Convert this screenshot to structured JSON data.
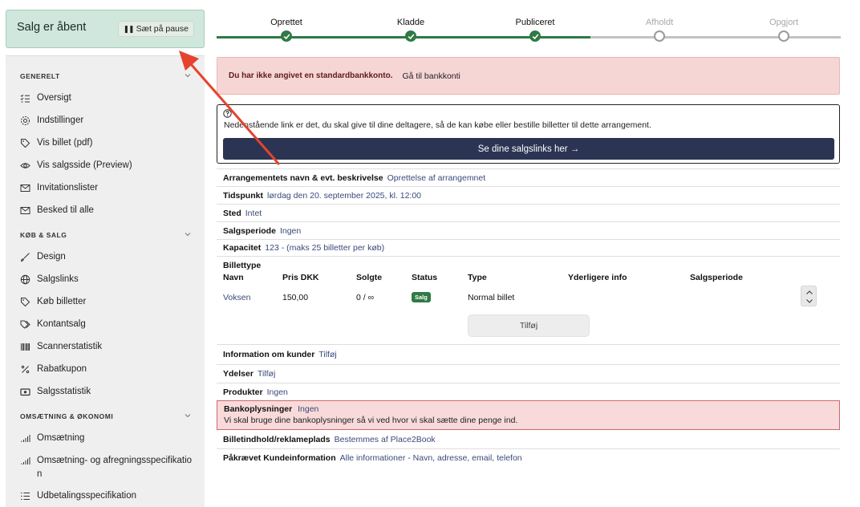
{
  "sales_status": {
    "title": "Salg er åbent",
    "pause_label": "Sæt på pause"
  },
  "sidebar": {
    "sections": [
      {
        "title": "GENERELT",
        "items": [
          "Oversigt",
          "Indstillinger",
          "Vis billet (pdf)",
          "Vis salgsside (Preview)",
          "Invitationslister",
          "Besked til alle"
        ]
      },
      {
        "title": "KØB & SALG",
        "items": [
          "Design",
          "Salgslinks",
          "Køb billetter",
          "Kontantsalg",
          "Scannerstatistik",
          "Rabatkupon",
          "Salgsstatistik"
        ]
      },
      {
        "title": "OMSÆTNING & ØKONOMI",
        "items": [
          "Omsætning",
          "Omsætning- og afregningsspecifikation",
          "Udbetalingsspecifikation"
        ]
      }
    ]
  },
  "stepper": {
    "steps": [
      {
        "label": "Oprettet",
        "done": true
      },
      {
        "label": "Kladde",
        "done": true
      },
      {
        "label": "Publiceret",
        "done": true
      },
      {
        "label": "Afholdt",
        "done": false
      },
      {
        "label": "Opgjort",
        "done": false
      }
    ],
    "colors": {
      "done": "#2f7a46",
      "todo": "#9a9a9a"
    }
  },
  "alert": {
    "text": "Du har ikke angivet en standardbankkonto.",
    "link": "Gå til bankkonti"
  },
  "info": {
    "message": "Nedenstående link er det, du skal give til dine deltagere, så de kan købe eller bestille billetter til dette arrangement.",
    "cta": "Se dine salgslinks her →"
  },
  "details": {
    "name": {
      "label": "Arrangementets navn & evt. beskrivelse",
      "value": "Oprettelse af arrangemnet"
    },
    "time": {
      "label": "Tidspunkt",
      "value": "lørdag den 20. september 2025, kl. 12:00"
    },
    "place": {
      "label": "Sted",
      "value": "Intet"
    },
    "period": {
      "label": "Salgsperiode",
      "value": "Ingen"
    },
    "capacity": {
      "label": "Kapacitet",
      "value": "123 - (maks 25 billetter per køb)"
    }
  },
  "tickets": {
    "title": "Billettype",
    "columns": [
      "Navn",
      "Pris DKK",
      "Solgte",
      "Status",
      "Type",
      "Yderligere info",
      "Salgsperiode"
    ],
    "rows": [
      {
        "name": "Voksen",
        "price": "150,00",
        "sold": "0 / ∞",
        "status": "Salg",
        "type": "Normal billet"
      }
    ],
    "add_label": "Tilføj"
  },
  "customer_info": {
    "label": "Information om kunder",
    "value": "Tilføj"
  },
  "services": {
    "label": "Ydelser",
    "value": "Tilføj"
  },
  "products": {
    "label": "Produkter",
    "value": "Ingen"
  },
  "bank": {
    "label": "Bankoplysninger",
    "value": "Ingen",
    "desc": "Vi skal bruge dine bankoplysninger så vi ved hvor vi skal sætte dine penge ind."
  },
  "ticket_content": {
    "label": "Billetindhold/reklameplads",
    "value": "Bestemmes af Place2Book"
  },
  "required_info": {
    "label": "Påkrævet Kundeinformation",
    "value": "Alle informationer - Navn, adresse, email, telefon"
  },
  "accent_colors": {
    "annotation_arrow": "#e5432e",
    "cta": "#2b3553"
  }
}
